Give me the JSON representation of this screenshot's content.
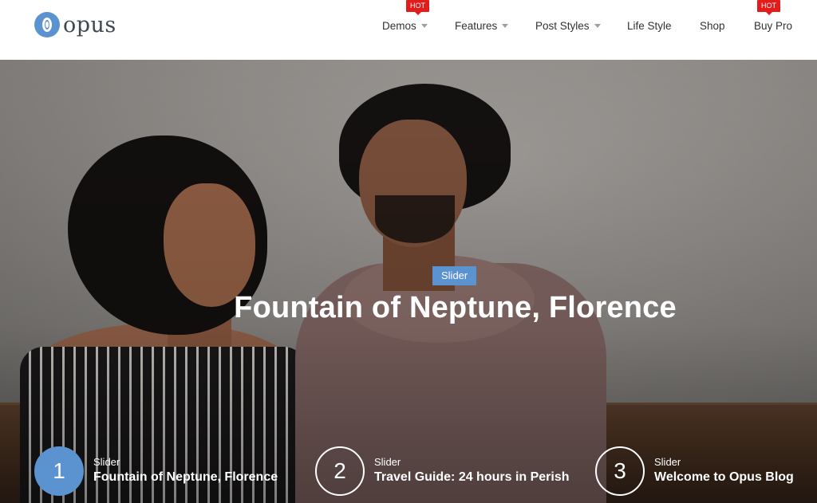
{
  "logo": {
    "text": "opus"
  },
  "nav": [
    {
      "label": "Demos",
      "has_dropdown": true,
      "badge": "HOT"
    },
    {
      "label": "Features",
      "has_dropdown": true
    },
    {
      "label": "Post Styles",
      "has_dropdown": true
    },
    {
      "label": "Life Style"
    },
    {
      "label": "Shop"
    },
    {
      "label": "Buy Pro",
      "badge": "HOT"
    }
  ],
  "hero": {
    "category": "Slider",
    "title": "Fountain of Neptune, Florence"
  },
  "slides": [
    {
      "number": "1",
      "category": "Slider",
      "title": "Fountain of Neptune, Florence",
      "active": true
    },
    {
      "number": "2",
      "category": "Slider",
      "title": "Travel Guide: 24 hours in Perish",
      "active": false
    },
    {
      "number": "3",
      "category": "Slider",
      "title": "Welcome to Opus Blog",
      "active": false
    }
  ],
  "colors": {
    "accent": "#5b93d1",
    "hot_badge": "#e31b1b"
  },
  "icons": {
    "dropdown": "chevron-down-icon",
    "logo": "opus-logo-icon"
  }
}
